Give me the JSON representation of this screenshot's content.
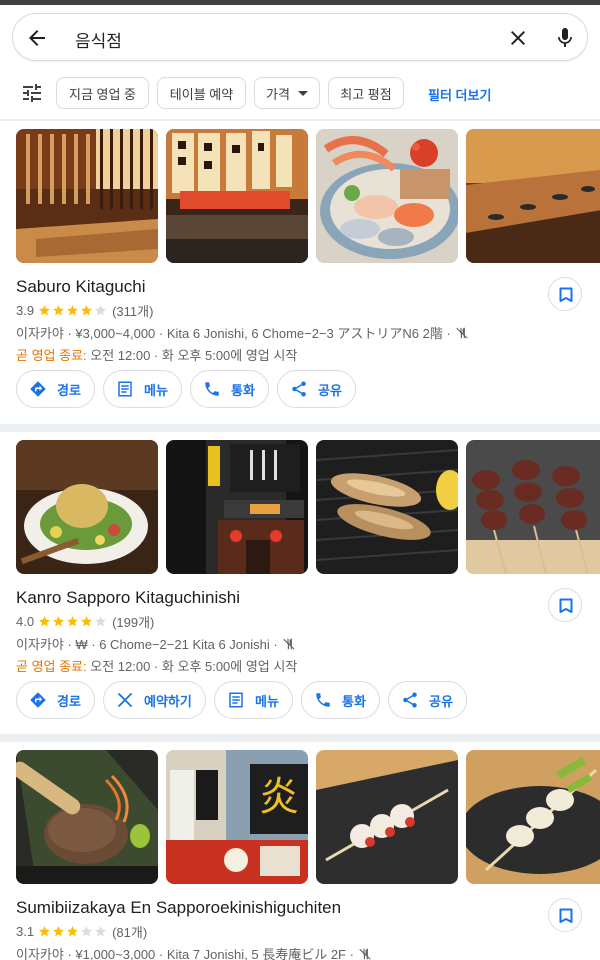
{
  "search": {
    "query": "음식점"
  },
  "filters": {
    "chips": [
      "지금 영업 중",
      "테이블 예약",
      "가격",
      "최고 평점"
    ],
    "more_label": "필터 더보기"
  },
  "colors": {
    "accent": "#1a73e8",
    "star": "#fbbc04",
    "closing_soon": "#e37400"
  },
  "results": [
    {
      "name": "Saburo Kitaguchi",
      "rating": "3.9",
      "stars": 4,
      "review_count": "(311개)",
      "details": "이자카야 · ¥3,000~4,000 · Kita 6 Jonishi, 6 Chome−2−3 アストリアN6 2階 ·",
      "status_label": "곧 영업 종료:",
      "status_hours": " 오전 12:00 · 화 오후 5:00에 영업 시작",
      "actions": [
        "경로",
        "메뉴",
        "통화",
        "공유"
      ]
    },
    {
      "name": "Kanro Sapporo Kitaguchinishi",
      "rating": "4.0",
      "stars": 4,
      "review_count": "(199개)",
      "details": "이자카야 · ₩ · 6 Chome−2−21 Kita 6 Jonishi ·",
      "status_label": "곧 영업 종료:",
      "status_hours": " 오전 12:00 · 화 오후 5:00에 영업 시작",
      "actions": [
        "경로",
        "예약하기",
        "메뉴",
        "통화",
        "공유"
      ]
    },
    {
      "name": "Sumibiizakaya En Sapporoekinishiguchiten",
      "rating": "3.1",
      "stars": 3,
      "review_count": "(81개)",
      "details": "이자카야 · ¥1,000~3,000 · Kita 7 Jonishi, 5 長寿庵ビル 2F ·"
    }
  ]
}
